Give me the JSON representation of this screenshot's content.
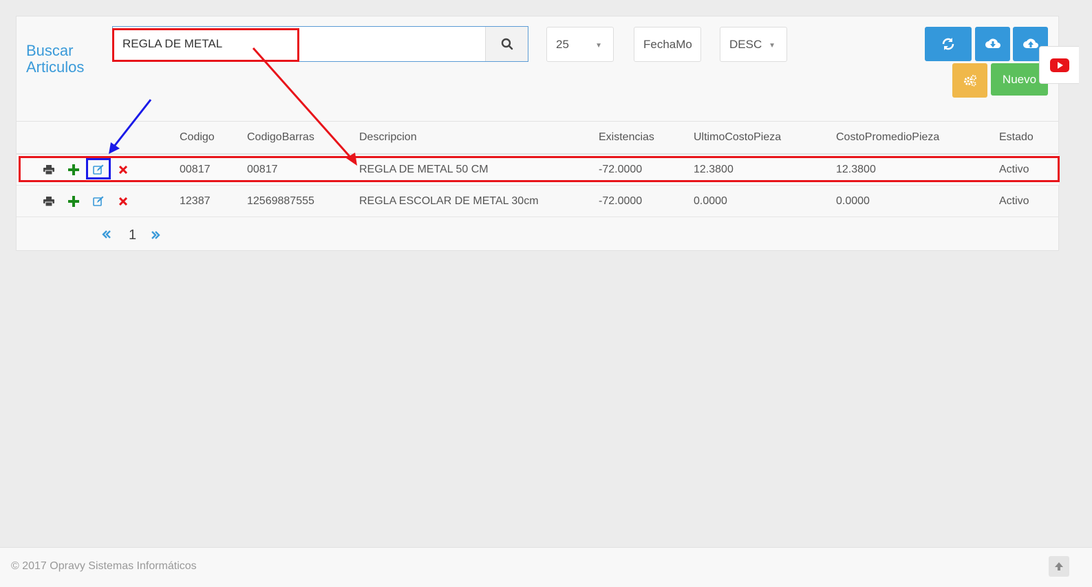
{
  "page": {
    "title": "Buscar Articulos"
  },
  "search": {
    "value": "REGLA DE METAL",
    "placeholder": ""
  },
  "filters": {
    "page_size": "25",
    "sort_field": "FechaMo",
    "sort_dir": "DESC"
  },
  "buttons": {
    "new_label": "Nuevo"
  },
  "table": {
    "headers": [
      "Codigo",
      "CodigoBarras",
      "Descripcion",
      "Existencias",
      "UltimoCostoPieza",
      "CostoPromedioPieza",
      "Estado"
    ],
    "rows": [
      {
        "codigo": "00817",
        "codigo_barras": "00817",
        "descripcion": "REGLA DE METAL 50 CM",
        "existencias": "-72.0000",
        "ultimo_costo": "12.3800",
        "costo_promedio": "12.3800",
        "estado": "Activo"
      },
      {
        "codigo": "12387",
        "codigo_barras": "12569887555",
        "descripcion": "REGLA ESCOLAR DE METAL 30cm",
        "existencias": "-72.0000",
        "ultimo_costo": "0.0000",
        "costo_promedio": "0.0000",
        "estado": "Activo"
      }
    ]
  },
  "pagination": {
    "current": "1"
  },
  "footer": {
    "text": "© 2017 Opravy Sistemas Informáticos"
  },
  "colors": {
    "accent": "#3498db",
    "annotation_red": "#e8141a",
    "annotation_blue": "#1a1ae8"
  }
}
